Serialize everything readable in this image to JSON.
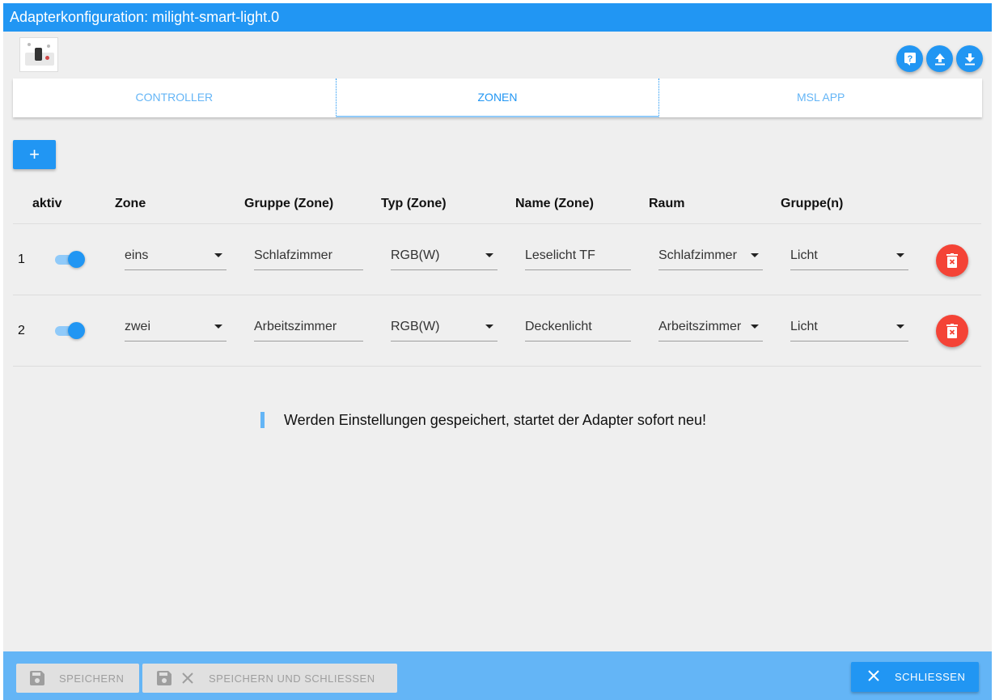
{
  "window": {
    "title": "Adapterkonfiguration: milight-smart-light.0"
  },
  "header_buttons": {
    "help_icon": "help-icon",
    "upload_icon": "upload-icon",
    "download_icon": "download-icon"
  },
  "tabs": [
    {
      "label": "CONTROLLER",
      "active": false
    },
    {
      "label": "ZONEN",
      "active": true
    },
    {
      "label": "MSL APP",
      "active": false
    }
  ],
  "add_button": {
    "label": "+"
  },
  "table": {
    "columns": [
      "aktiv",
      "Zone",
      "Gruppe (Zone)",
      "Typ (Zone)",
      "Name (Zone)",
      "Raum",
      "Gruppe(n)"
    ],
    "rows": [
      {
        "num": "1",
        "aktiv": true,
        "zone": "eins",
        "gruppe_zone": "Schlafzimmer",
        "typ": "RGB(W)",
        "name": "Leselicht TF",
        "raum": "Schlafzimmer",
        "gruppen": "Licht"
      },
      {
        "num": "2",
        "aktiv": true,
        "zone": "zwei",
        "gruppe_zone": "Arbeitszimmer",
        "typ": "RGB(W)",
        "name": "Deckenlicht",
        "raum": "Arbeitszimmer",
        "gruppen": "Licht"
      }
    ]
  },
  "notice": "Werden Einstellungen gespeichert, startet der Adapter sofort neu!",
  "footer": {
    "save_label": "SPEICHERN",
    "save_close_label": "SPEICHERN UND SCHLIESSEN",
    "close_label": "SCHLIESSEN"
  },
  "colors": {
    "primary": "#2196f3",
    "footer": "#64b5f6",
    "danger": "#f44336",
    "background": "#efefef"
  }
}
